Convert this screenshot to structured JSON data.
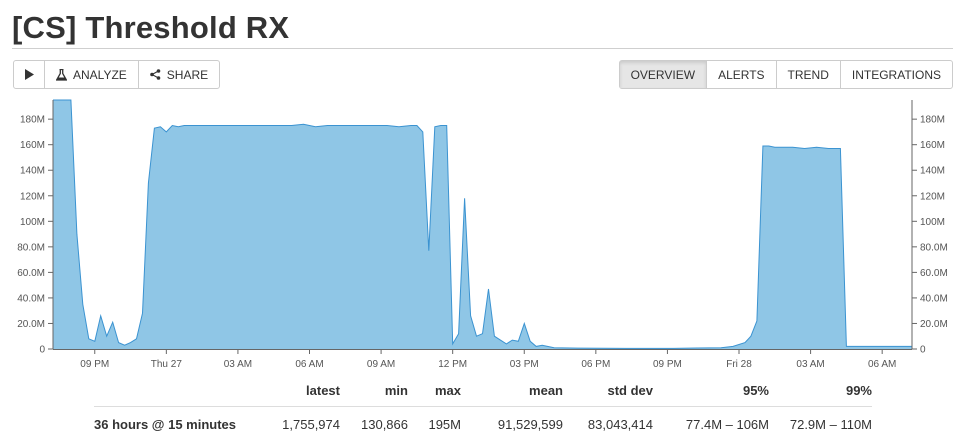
{
  "page": {
    "title": "[CS] Threshold RX"
  },
  "toolbar": {
    "play_icon": "play-icon",
    "analyze_label": "ANALYZE",
    "analyze_icon": "flask-icon",
    "share_label": "SHARE",
    "share_icon": "share-icon"
  },
  "tabs": [
    {
      "label": "OVERVIEW",
      "active": true
    },
    {
      "label": "ALERTS",
      "active": false
    },
    {
      "label": "TREND",
      "active": false
    },
    {
      "label": "INTEGRATIONS",
      "active": false
    }
  ],
  "chart_data": {
    "type": "area",
    "color": "#8fc6e6",
    "stroke": "#3b93d1",
    "ylim": [
      0,
      195
    ],
    "y_ticks": [
      "0",
      "20.0M",
      "40.0M",
      "60.0M",
      "80.0M",
      "100M",
      "120M",
      "140M",
      "160M",
      "180M"
    ],
    "y_tick_values": [
      0,
      20,
      40,
      60,
      80,
      100,
      120,
      140,
      160,
      180
    ],
    "y_unit": "M",
    "xlim": [
      0,
      36
    ],
    "x_ticks": [
      "09 PM",
      "Thu 27",
      "03 AM",
      "06 AM",
      "09 AM",
      "12 PM",
      "03 PM",
      "06 PM",
      "09 PM",
      "Fri 28",
      "03 AM",
      "06 AM"
    ],
    "x_tick_hours": [
      1.75,
      4.75,
      7.75,
      10.75,
      13.75,
      16.75,
      19.75,
      22.75,
      25.75,
      28.75,
      31.75,
      34.75
    ],
    "series": [
      {
        "x": [
          0,
          0.75,
          1.0,
          1.25,
          1.5,
          1.75,
          2.0,
          2.25,
          2.5,
          2.75,
          3.0,
          3.25,
          3.5,
          3.75,
          4.0,
          4.25,
          4.5,
          4.75,
          5.0,
          5.25,
          5.5,
          6.0,
          7.0,
          8.0,
          9.0,
          10.0,
          10.5,
          11.0,
          11.5,
          12.0,
          13.0,
          14.0,
          14.5,
          15.0,
          15.25,
          15.5,
          15.75,
          16.0,
          16.25,
          16.5,
          16.75,
          17.0,
          17.25,
          17.5,
          17.75,
          18.0,
          18.25,
          18.5,
          18.75,
          19.0,
          19.25,
          19.5,
          19.75,
          20.0,
          20.25,
          20.5,
          21.0,
          22.0,
          24.0,
          26.0,
          27.0,
          28.0,
          28.5,
          29.0,
          29.25,
          29.5,
          29.75,
          30.0,
          30.25,
          30.5,
          31.0,
          31.5,
          32.0,
          32.5,
          33.0,
          33.25,
          34.0,
          35.0,
          36.0
        ],
        "y": [
          195,
          195,
          90,
          35,
          8,
          6,
          26,
          10,
          21,
          5,
          3,
          5,
          8,
          28,
          130,
          173,
          174,
          170,
          175,
          174,
          175,
          175,
          175,
          175,
          175,
          175,
          176,
          174,
          175,
          175,
          175,
          175,
          174,
          175,
          175,
          170,
          77,
          174,
          175,
          175,
          4,
          12,
          118,
          26,
          10,
          12,
          47,
          10,
          7,
          4,
          7,
          6,
          20,
          6,
          2,
          3,
          1,
          0.7,
          0.5,
          0.5,
          0.8,
          1,
          2,
          5,
          10,
          22,
          159,
          159,
          158,
          158,
          158,
          157,
          158,
          157,
          157,
          2,
          2,
          2,
          2
        ]
      }
    ],
    "stats": {
      "headers": [
        "latest",
        "min",
        "max",
        "mean",
        "std dev",
        "95%",
        "99%"
      ],
      "row_label": "36 hours @ 15 minutes",
      "values": [
        "1,755,974",
        "130,866",
        "195M",
        "91,529,599",
        "83,043,414",
        "77.4M – 106M",
        "72.9M – 110M"
      ]
    }
  }
}
